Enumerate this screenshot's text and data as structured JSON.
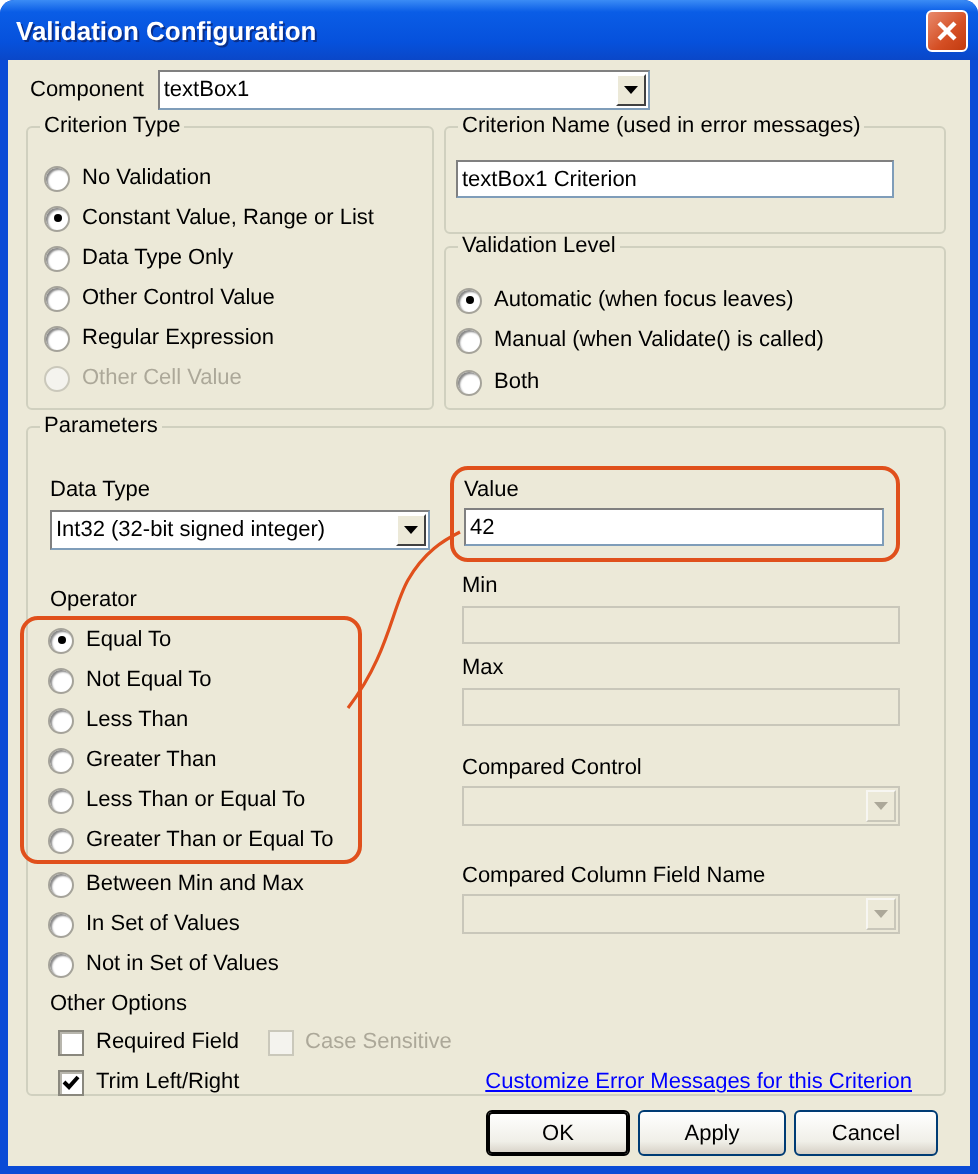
{
  "window": {
    "title": "Validation Configuration"
  },
  "component": {
    "label": "Component",
    "value": "textBox1"
  },
  "criterion_type": {
    "title": "Criterion Type",
    "options": [
      {
        "label": "No Validation",
        "selected": false,
        "disabled": false
      },
      {
        "label": "Constant Value, Range or List",
        "selected": true,
        "disabled": false
      },
      {
        "label": "Data Type Only",
        "selected": false,
        "disabled": false
      },
      {
        "label": "Other Control Value",
        "selected": false,
        "disabled": false
      },
      {
        "label": "Regular Expression",
        "selected": false,
        "disabled": false
      },
      {
        "label": "Other Cell Value",
        "selected": false,
        "disabled": true
      }
    ]
  },
  "criterion_name": {
    "title": "Criterion Name (used in error messages)",
    "value": "textBox1 Criterion"
  },
  "validation_level": {
    "title": "Validation Level",
    "options": [
      {
        "label": "Automatic (when focus leaves)",
        "selected": true
      },
      {
        "label": "Manual (when Validate() is called)",
        "selected": false
      },
      {
        "label": "Both",
        "selected": false
      }
    ]
  },
  "parameters": {
    "title": "Parameters",
    "data_type": {
      "label": "Data Type",
      "value": "Int32 (32-bit signed integer)"
    },
    "operator": {
      "label": "Operator",
      "groups": [
        {
          "highlighted": true,
          "options": [
            {
              "label": "Equal To",
              "selected": true
            },
            {
              "label": "Not Equal To",
              "selected": false
            },
            {
              "label": "Less Than",
              "selected": false
            },
            {
              "label": "Greater Than",
              "selected": false
            },
            {
              "label": "Less Than or Equal To",
              "selected": false
            },
            {
              "label": "Greater Than or Equal To",
              "selected": false
            }
          ]
        },
        {
          "highlighted": false,
          "options": [
            {
              "label": "Between Min and Max",
              "selected": false
            },
            {
              "label": "In Set of Values",
              "selected": false
            },
            {
              "label": "Not in Set of Values",
              "selected": false
            }
          ]
        }
      ]
    },
    "value": {
      "label": "Value",
      "value": "42",
      "highlighted": true
    },
    "min": {
      "label": "Min",
      "disabled": true
    },
    "max": {
      "label": "Max",
      "disabled": true
    },
    "compared_control": {
      "label": "Compared Control",
      "disabled": true
    },
    "compared_column": {
      "label": "Compared Column Field Name",
      "disabled": true
    },
    "other_options": {
      "label": "Other Options",
      "options": [
        {
          "label": "Required Field",
          "checked": false,
          "disabled": false
        },
        {
          "label": "Case Sensitive",
          "checked": false,
          "disabled": true
        },
        {
          "label": "Trim Left/Right",
          "checked": true,
          "disabled": false
        }
      ]
    },
    "link": "Customize Error Messages for this Criterion"
  },
  "buttons": [
    {
      "label": "OK",
      "default": true
    },
    {
      "label": "Apply",
      "default": false
    },
    {
      "label": "Cancel",
      "default": false
    }
  ]
}
